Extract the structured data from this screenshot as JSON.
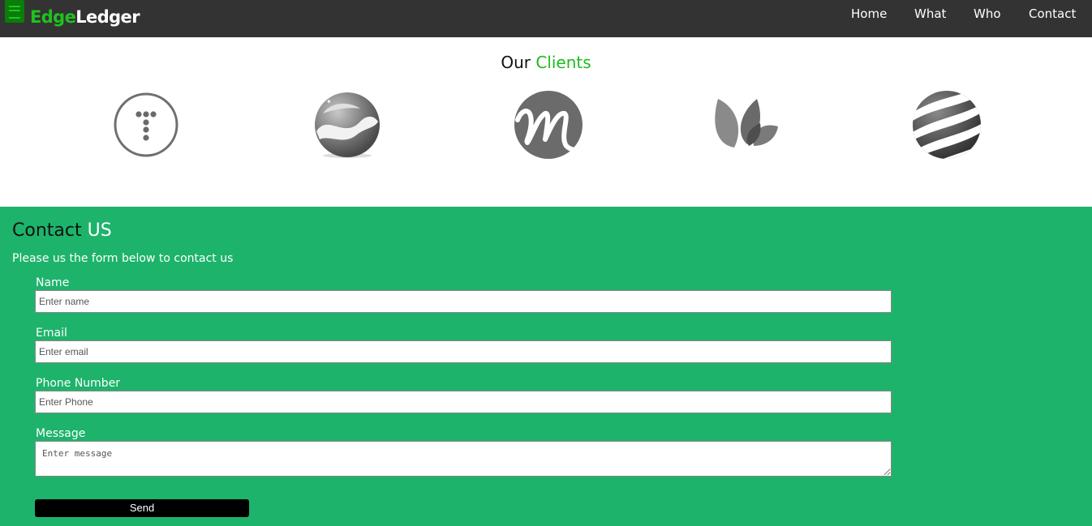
{
  "brand": {
    "name_part1": "Edge",
    "name_part2": "Ledger"
  },
  "nav": {
    "home": "Home",
    "what": "What",
    "who": "Who",
    "contact": "Contact"
  },
  "clients": {
    "title_part1": "Our ",
    "title_part2": "Clients",
    "logos": [
      "t-dots-logo",
      "wave-sphere-logo",
      "m-script-logo",
      "leaves-logo",
      "striped-globe-logo"
    ]
  },
  "contact": {
    "title_part1": "Contact ",
    "title_part2": "US",
    "subtitle": "Please us the form below to contact us",
    "name_label": "Name",
    "name_placeholder": "Enter name",
    "email_label": "Email",
    "email_placeholder": "Enter email",
    "phone_label": "Phone Number",
    "phone_placeholder": "Enter Phone",
    "message_label": "Message",
    "message_placeholder": "Enter message",
    "send_label": "Send"
  },
  "colors": {
    "navbar": "#333333",
    "brand_green": "#1fc21f",
    "contact_bg": "#1db36b",
    "button_bg": "#000000"
  }
}
